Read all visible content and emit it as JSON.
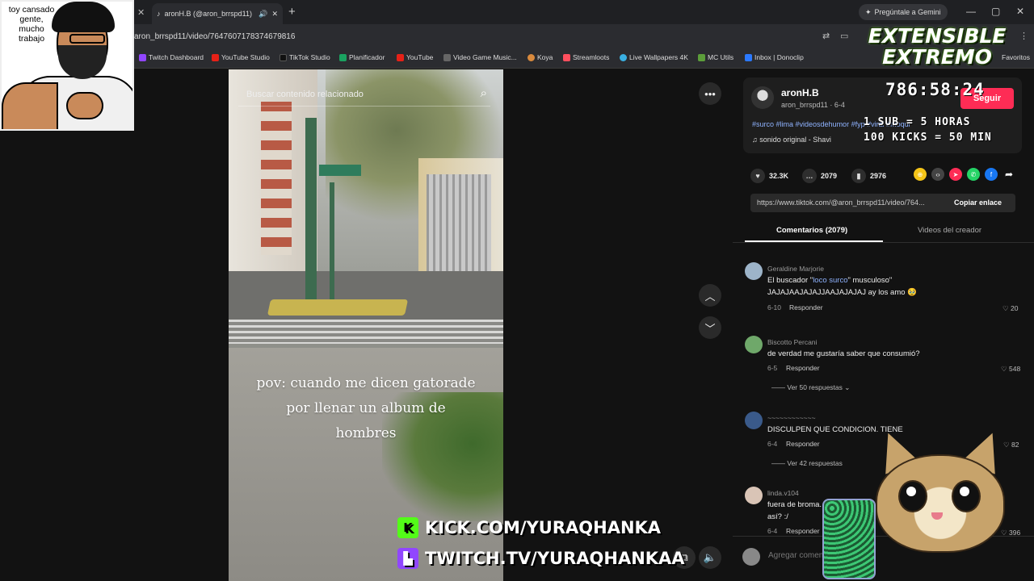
{
  "browser": {
    "tab_title": "aronH.B (@aron_brrspd11)",
    "url": "aron_brrspd11/video/7647607178374679816",
    "gemini_label": "Pregúntale a Gemini",
    "bookmarks": [
      "Twitch Dashboard",
      "YouTube Studio",
      "TikTok Studio",
      "Planificador",
      "YouTube",
      "Video Game Music...",
      "Koya",
      "Streamloots",
      "Live Wallpapers 4K",
      "MC Utils",
      "Inbox | Donoclip"
    ],
    "bookmarks_more": "Favoritos"
  },
  "video": {
    "search_placeholder": "Buscar contenido relacionado",
    "caption_lines": [
      "pov: cuando me dicen gatorade",
      "por llenar un album de",
      "hombres"
    ]
  },
  "author": {
    "name": "aronH.B",
    "handle": "aron_brrspd11 · 6-4",
    "follow_label": "Seguir",
    "tags": "#surco #lima #videosdehumor #fyp #viral #moqui",
    "sound": "sonido original - Shavi"
  },
  "stats": {
    "likes": "32.3K",
    "comments": "2079",
    "saves": "2976"
  },
  "link": {
    "url": "https://www.tiktok.com/@aron_brrspd11/video/764...",
    "copy_label": "Copiar enlace"
  },
  "tabs": {
    "comments": "Comentarios (2079)",
    "creator_videos": "Videos del creador"
  },
  "comments": [
    {
      "name": "Geraldine Marjorie",
      "text_a": "El buscador \"",
      "text_hl": "loco surco",
      "text_b": "\" musculoso\"",
      "text2": "JAJAJAAJAJAJJAAJAJAJAJ ay los amo 🥹",
      "date": "6-10",
      "reply": "Responder",
      "likes": "20"
    },
    {
      "name": "Biscotto Percani",
      "text": "de verdad me gustaría saber que consumió?",
      "date": "6-5",
      "reply": "Responder",
      "likes": "548",
      "more": "Ver 50 respuestas"
    },
    {
      "name": "~~~~~~~~~~~~",
      "text": "DISCULPEN QUE CONDICION. TIENE",
      "date": "6-4",
      "reply": "Responder",
      "likes": "82",
      "more": "Ver 42 respuestas"
    },
    {
      "name": "linda.v104",
      "text": "fuera de broma. Algu...",
      "text2": "así? :/",
      "date": "6-4",
      "reply": "Responder",
      "likes": "396"
    }
  ],
  "comment_input_placeholder": "Agregar comentario...",
  "overlay": {
    "webcam_text": "toy cansado gente, mucho trabajo",
    "title_line1": "EXTENSIBLE",
    "title_line2": "EXTREMO",
    "timer": "786:58:24",
    "rule1": "1 SUB = 5 HORAS",
    "rule2": "100 KICKS = 50 MIN",
    "kick": "KICK.COM/YURAQHANKA",
    "twitch": "TWITCH.TV/YURAQHANKAA"
  },
  "colors": {
    "accent": "#fe2c55",
    "kick": "#53fc18",
    "twitch": "#9146ff",
    "link_blue": "#8fb3ff"
  }
}
